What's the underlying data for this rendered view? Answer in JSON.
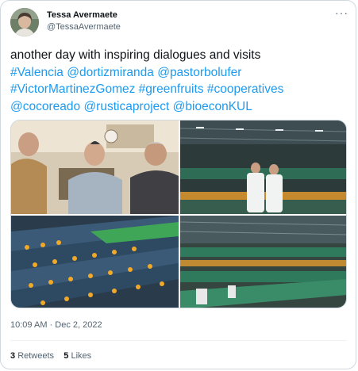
{
  "author": {
    "name": "Tessa Avermaete",
    "handle": "@TessaAvermaete"
  },
  "tweet": {
    "line1": "another day with inspiring dialogues and visits",
    "line2_tags": [
      "#Valencia",
      "@dortizmiranda",
      "@pastorbolufer"
    ],
    "line3_tags": [
      "#VictorMartinezGomez",
      "#greenfruits",
      "#cooperatives"
    ],
    "line4_tags": [
      "@cocoreado",
      "@rusticaproject",
      "@bioeconKUL"
    ]
  },
  "photos": [
    {
      "label": "photo-group-meeting"
    },
    {
      "label": "photo-warehouse-two-people"
    },
    {
      "label": "photo-fruit-sorting-line"
    },
    {
      "label": "photo-packing-hall"
    }
  ],
  "meta": {
    "timestamp": "10:09 AM · Dec 2, 2022"
  },
  "stats": {
    "retweets_count": "3",
    "retweets_label": "Retweets",
    "likes_count": "5",
    "likes_label": "Likes"
  },
  "icons": {
    "more": "more-horizontal-icon"
  },
  "colors": {
    "link": "#1d9bf0",
    "secondary_text": "#536471",
    "border": "#cfd9de"
  }
}
